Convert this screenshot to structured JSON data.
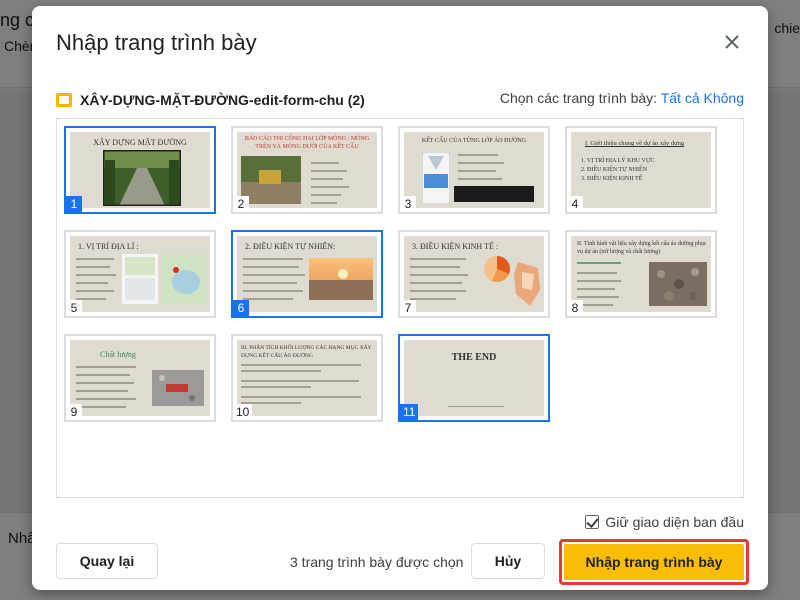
{
  "background": {
    "left_title": "ng có",
    "left_menu": "Chèn",
    "right_menu": "chie",
    "notes_text": "Nhấ"
  },
  "dialog": {
    "title": "Nhập trang trình bày",
    "file_name": "XÂY-DỰNG-MẶT-ĐƯỜNG-edit-form-chu (2)",
    "select_label": "Chọn các trang trình bày:",
    "select_all": "Tất cả",
    "select_none": "Không",
    "slides": [
      {
        "number": "1",
        "selected": true,
        "title": "XÂY DỰNG MẶT ĐƯỜNG"
      },
      {
        "number": "2",
        "selected": false,
        "title": "BÁO CÁO THI CÔNG HAI LỚP MÓNG : MÓNG TRÊN VÀ MÓNG DƯỚI CỦA KẾT CẤU"
      },
      {
        "number": "3",
        "selected": false,
        "title": "KẾT CẤU CỦA TỪNG LỚP ÁO ĐƯỜNG"
      },
      {
        "number": "4",
        "selected": false,
        "title": "I. Giới thiệu chung về dự án xây dựng",
        "bullets": [
          "1. VỊ TRÍ ĐỊA LÝ KHU VỰC",
          "2. ĐIỀU KIỆN TỰ NHIÊN",
          "3. ĐIỀU KIỆN KINH TẾ"
        ]
      },
      {
        "number": "5",
        "selected": false,
        "title": "1. VỊ TRÍ ĐỊA LÍ :"
      },
      {
        "number": "6",
        "selected": true,
        "title": "2. ĐIỀU KIỆN TỰ NHIÊN:"
      },
      {
        "number": "7",
        "selected": false,
        "title": "3. ĐIỀU KIỆN KINH TẾ :"
      },
      {
        "number": "8",
        "selected": false,
        "title": "II. Tình hình vật liệu xây dựng kết cấu áo đường phục vụ dự án (trữ lượng và chất lượng)"
      },
      {
        "number": "9",
        "selected": false,
        "title": "Chất lượng"
      },
      {
        "number": "10",
        "selected": false,
        "title": "III. PHÂN TÍCH KHỐI LƯỢNG CÁC HẠNG MỤC XÂY DỰNG KẾT CẤU ÁO ĐƯỜNG"
      },
      {
        "number": "11",
        "selected": true,
        "title": "THE END"
      }
    ],
    "keep_theme_label": "Giữ giao diện ban đầu",
    "keep_theme_checked": true,
    "back_label": "Quay lại",
    "selected_count": "3 trang trình bày được chọn",
    "cancel_label": "Hủy",
    "import_label": "Nhập trang trình bày"
  },
  "colors": {
    "accent": "#1a73e8",
    "import_button": "#fbbc04",
    "highlight_border": "#e53935",
    "slide_bg": "#e0dbd0"
  }
}
